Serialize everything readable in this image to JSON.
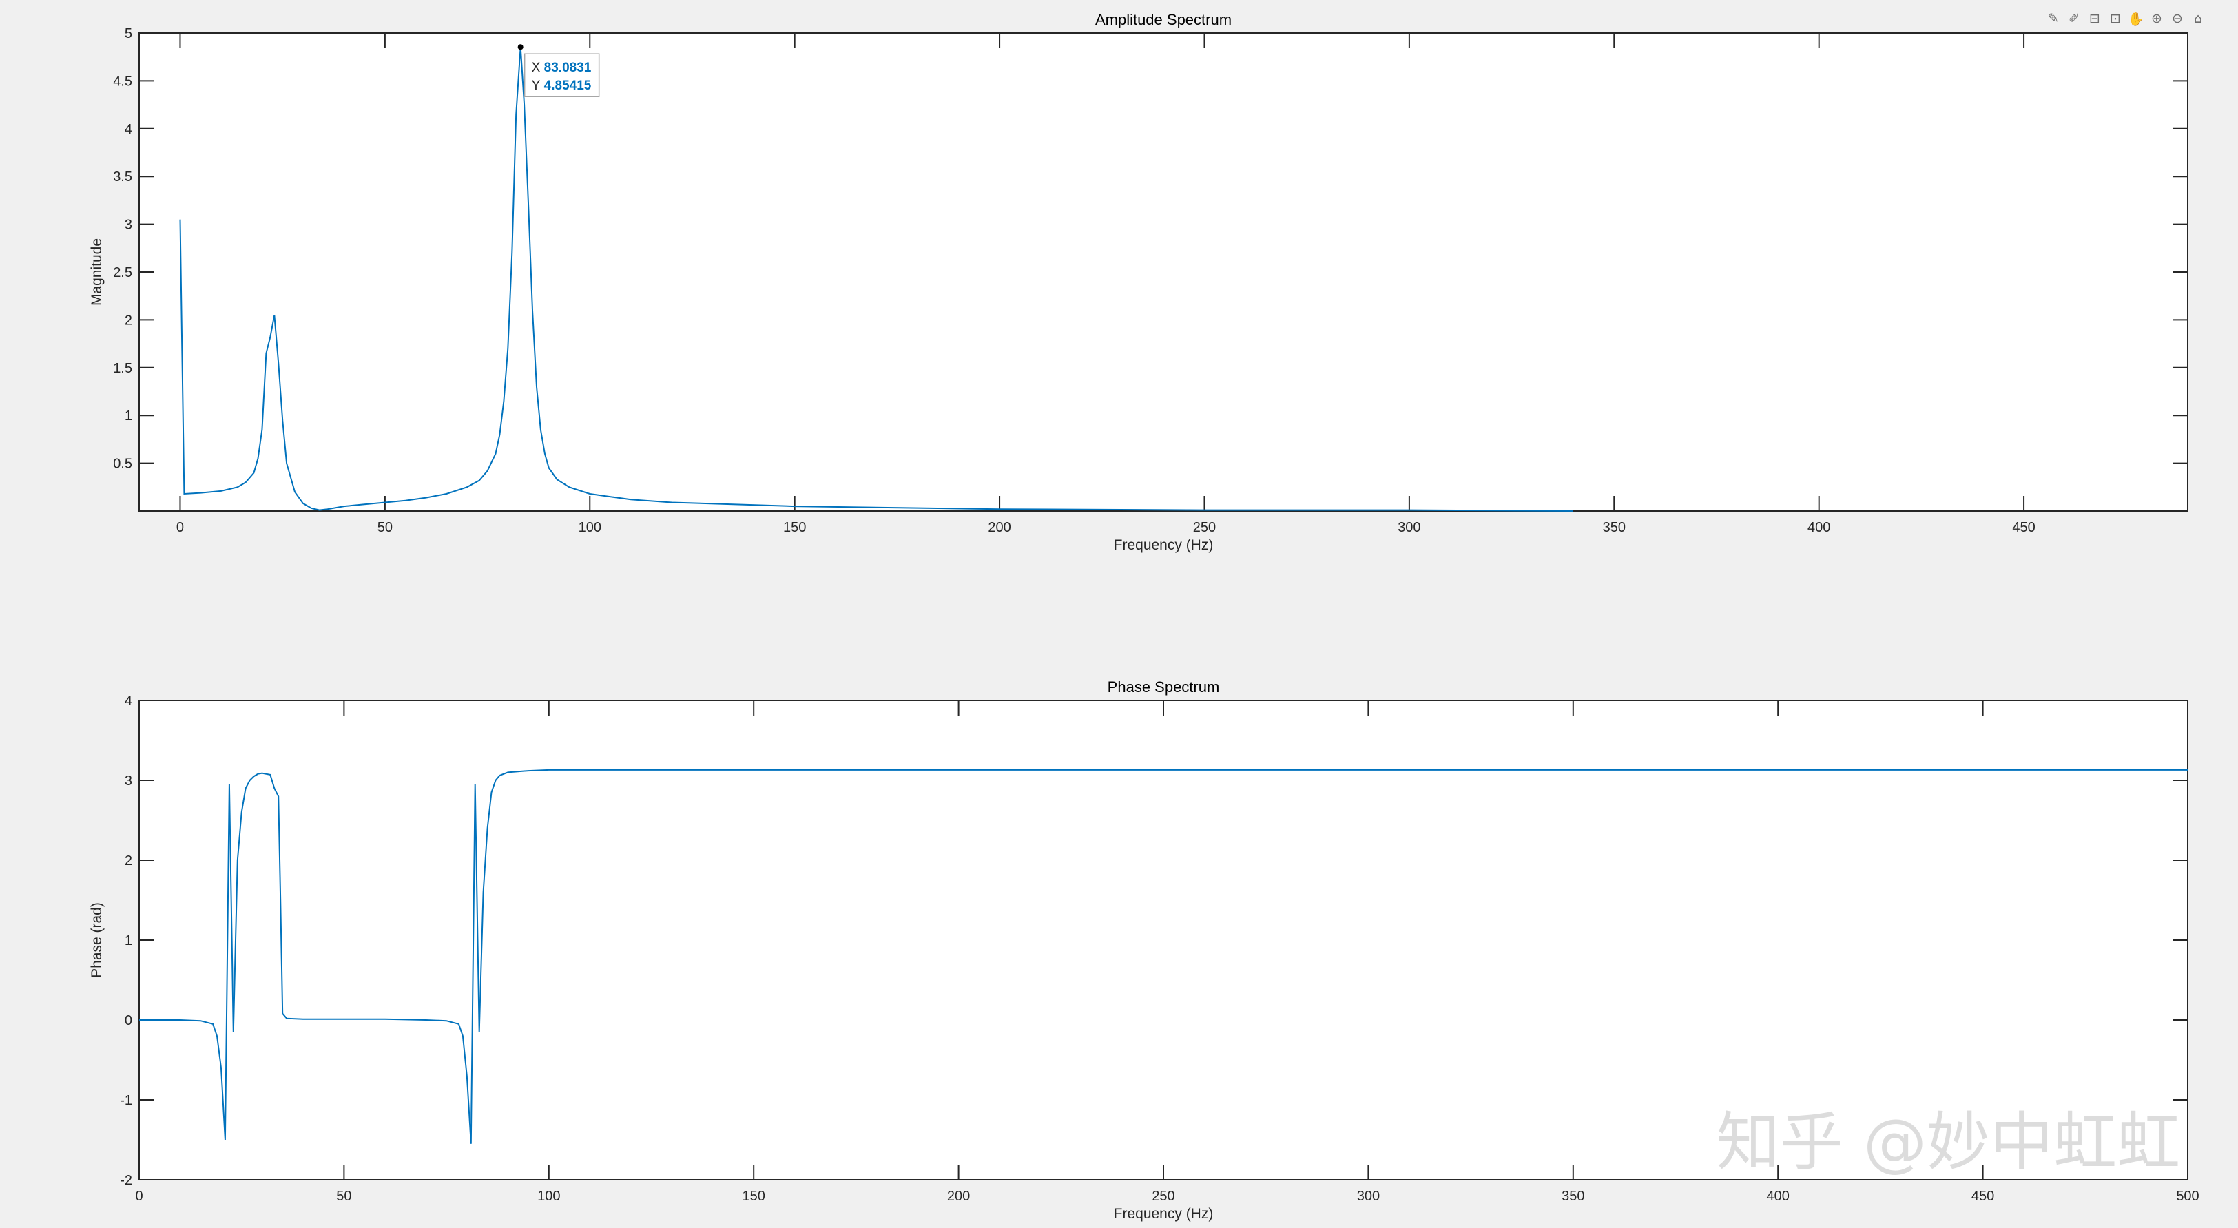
{
  "toolbar": {
    "buttons": [
      {
        "name": "export-icon",
        "glyph": "✎"
      },
      {
        "name": "brush-icon",
        "glyph": "✐"
      },
      {
        "name": "datatip-icon",
        "glyph": "⊟"
      },
      {
        "name": "rotate-icon",
        "glyph": "⊡"
      },
      {
        "name": "pan-icon",
        "glyph": "✋"
      },
      {
        "name": "zoom-in-icon",
        "glyph": "⊕"
      },
      {
        "name": "zoom-out-icon",
        "glyph": "⊖"
      },
      {
        "name": "home-icon",
        "glyph": "⌂"
      }
    ],
    "active_index": 4
  },
  "watermark": "知乎 @妙中虹虹",
  "chart_data": [
    {
      "type": "line",
      "title": "Amplitude Spectrum",
      "xlabel": "Frequency (Hz)",
      "ylabel": "Magnitude",
      "xlim": [
        -10,
        490
      ],
      "ylim": [
        0,
        5
      ],
      "xticks": [
        0,
        50,
        100,
        150,
        200,
        250,
        300,
        350,
        400,
        450
      ],
      "yticks": [
        0.5,
        1,
        1.5,
        2,
        2.5,
        3,
        3.5,
        4,
        4.5,
        5
      ],
      "grid": false,
      "series": [
        {
          "color": "#0072bd",
          "x": [
            0,
            1,
            5,
            10,
            14,
            16,
            18,
            19,
            20,
            21,
            22,
            23,
            24,
            25,
            26,
            28,
            30,
            32,
            34,
            36,
            40,
            45,
            50,
            55,
            60,
            65,
            70,
            73,
            75,
            77,
            78,
            79,
            80,
            81,
            82,
            83.0831,
            84,
            85,
            86,
            87,
            88,
            89,
            90,
            92,
            95,
            100,
            110,
            120,
            150,
            200,
            250,
            300,
            340
          ],
          "y": [
            3.05,
            0.18,
            0.19,
            0.21,
            0.25,
            0.3,
            0.4,
            0.55,
            0.85,
            1.65,
            1.82,
            2.05,
            1.55,
            0.95,
            0.5,
            0.2,
            0.08,
            0.03,
            0.01,
            0.02,
            0.05,
            0.07,
            0.09,
            0.11,
            0.14,
            0.18,
            0.25,
            0.32,
            0.42,
            0.6,
            0.8,
            1.15,
            1.7,
            2.7,
            4.15,
            4.85415,
            4.25,
            3.2,
            2.1,
            1.3,
            0.85,
            0.6,
            0.45,
            0.33,
            0.25,
            0.18,
            0.12,
            0.09,
            0.05,
            0.02,
            0.01,
            0.01,
            0.0
          ]
        }
      ],
      "datatip": {
        "x_key": "X",
        "y_key": "Y",
        "x_value": "83.0831",
        "y_value": "4.85415",
        "x": 83.0831,
        "y": 4.85415
      }
    },
    {
      "type": "line",
      "title": "Phase Spectrum",
      "xlabel": "Frequency (Hz)",
      "ylabel": "Phase (rad)",
      "xlim": [
        0,
        500
      ],
      "ylim": [
        -2,
        4
      ],
      "xticks": [
        0,
        50,
        100,
        150,
        200,
        250,
        300,
        350,
        400,
        450,
        500
      ],
      "yticks": [
        -2,
        -1,
        0,
        1,
        2,
        3,
        4
      ],
      "grid": false,
      "series": [
        {
          "color": "#0072bd",
          "x": [
            0,
            5,
            10,
            15,
            18,
            19,
            20,
            21,
            22,
            23,
            24,
            25,
            26,
            27,
            28,
            29,
            30,
            32,
            33,
            34,
            34.5,
            35,
            36,
            40,
            50,
            60,
            70,
            75,
            78,
            79,
            80,
            81,
            82,
            83,
            84,
            85,
            86,
            87,
            88,
            90,
            95,
            100,
            200,
            300,
            400,
            500
          ],
          "y": [
            0,
            0,
            0,
            -0.01,
            -0.05,
            -0.2,
            -0.6,
            -1.5,
            2.95,
            -0.15,
            2.0,
            2.6,
            2.9,
            3.0,
            3.05,
            3.08,
            3.09,
            3.07,
            2.9,
            2.8,
            1.5,
            0.08,
            0.02,
            0.01,
            0.01,
            0.01,
            0.0,
            -0.01,
            -0.05,
            -0.2,
            -0.7,
            -1.55,
            2.95,
            -0.15,
            1.6,
            2.4,
            2.85,
            3.0,
            3.06,
            3.1,
            3.12,
            3.13,
            3.13,
            3.13,
            3.13,
            3.13
          ]
        }
      ]
    }
  ]
}
